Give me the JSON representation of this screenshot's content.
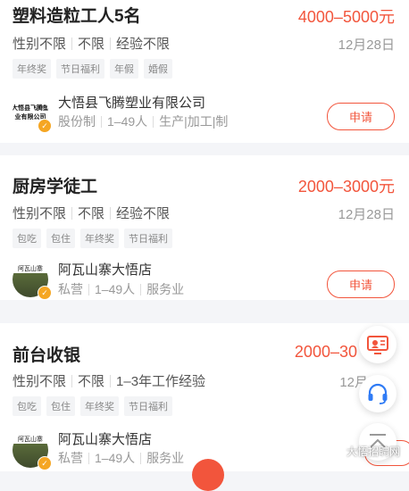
{
  "jobs": [
    {
      "title": "塑料造粒工人5名",
      "salary": "4000–5000元",
      "reqs": [
        "性别不限",
        "不限",
        "经验不限"
      ],
      "date": "12月28日",
      "tags": [
        "年终奖",
        "节日福利",
        "年假",
        "婚假"
      ],
      "company": "大悟县飞腾塑业有限公司",
      "company_meta": [
        "股份制",
        "1–49人",
        "生产|加工|制"
      ],
      "logo_text": "大悟县飞腾塑\n业有限公司",
      "apply_label": "申请"
    },
    {
      "title": "厨房学徒工",
      "salary": "2000–3000元",
      "reqs": [
        "性别不限",
        "不限",
        "经验不限"
      ],
      "date": "12月28日",
      "tags": [
        "包吃",
        "包住",
        "年终奖",
        "节日福利"
      ],
      "company": "阿瓦山寨大悟店",
      "company_meta": [
        "私营",
        "1–49人",
        "服务业"
      ],
      "logo_text": "阿瓦山寨",
      "apply_label": "申请"
    },
    {
      "title": "前台收银",
      "salary": "2000–30",
      "reqs": [
        "性别不限",
        "不限",
        "1–3年工作经验"
      ],
      "date": "12月",
      "tags": [
        "包吃",
        "包住",
        "年终奖",
        "节日福利"
      ],
      "company": "阿瓦山寨大悟店",
      "company_meta": [
        "私营",
        "1–49人",
        "服务业"
      ],
      "logo_text": "阿瓦山寨",
      "apply_label": "申"
    }
  ],
  "badge_glyph": "✓",
  "watermark": "大悟招聘网",
  "colors": {
    "accent": "#f2553c",
    "service_blue": "#2f7bf5"
  },
  "icons": {
    "resume": "resume-icon",
    "service": "headset-icon",
    "top": "back-to-top-icon"
  }
}
